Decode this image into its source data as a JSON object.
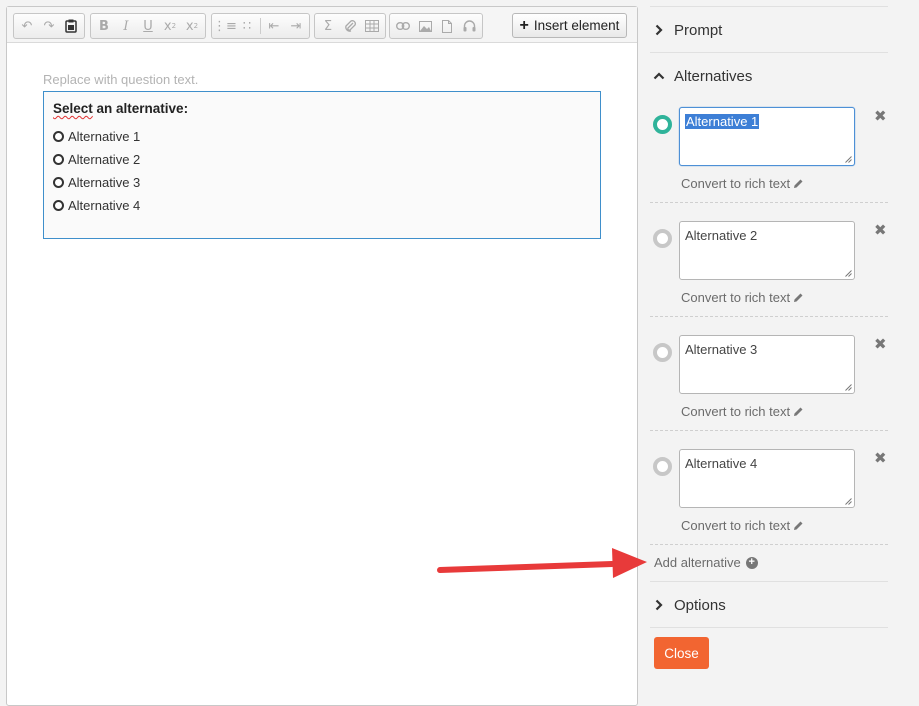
{
  "toolbar": {
    "insert_label": "Insert element",
    "icons": [
      "undo-icon",
      "redo-icon",
      "paste-icon",
      "bold-icon",
      "italic-icon",
      "underline-icon",
      "subscript-icon",
      "superscript-icon",
      "numbered-list-icon",
      "bullet-list-icon",
      "outdent-icon",
      "indent-icon",
      "sum-icon",
      "attachment-icon",
      "table-icon",
      "link-icon",
      "image-icon",
      "document-icon",
      "audio-icon"
    ]
  },
  "editor": {
    "placeholder": "Replace with question text.",
    "question_title_word": "Select",
    "question_title_rest": " an alternative:",
    "alternatives": [
      "Alternative 1",
      "Alternative 2",
      "Alternative 3",
      "Alternative 4"
    ]
  },
  "panel": {
    "prompt_label": "Prompt",
    "alternatives_label": "Alternatives",
    "options_label": "Options",
    "alternatives": [
      {
        "value": "Alternative 1",
        "selected": true
      },
      {
        "value": "Alternative 2",
        "selected": false
      },
      {
        "value": "Alternative 3",
        "selected": false
      },
      {
        "value": "Alternative 4",
        "selected": false
      }
    ],
    "convert_label": "Convert to rich text",
    "add_alternative_label": "Add alternative",
    "close_label": "Close"
  },
  "colors": {
    "accent_green": "#2fb39a",
    "close_orange": "#f26531",
    "arrow_red": "#e83a3a",
    "focus_blue": "#3f8fcb"
  }
}
